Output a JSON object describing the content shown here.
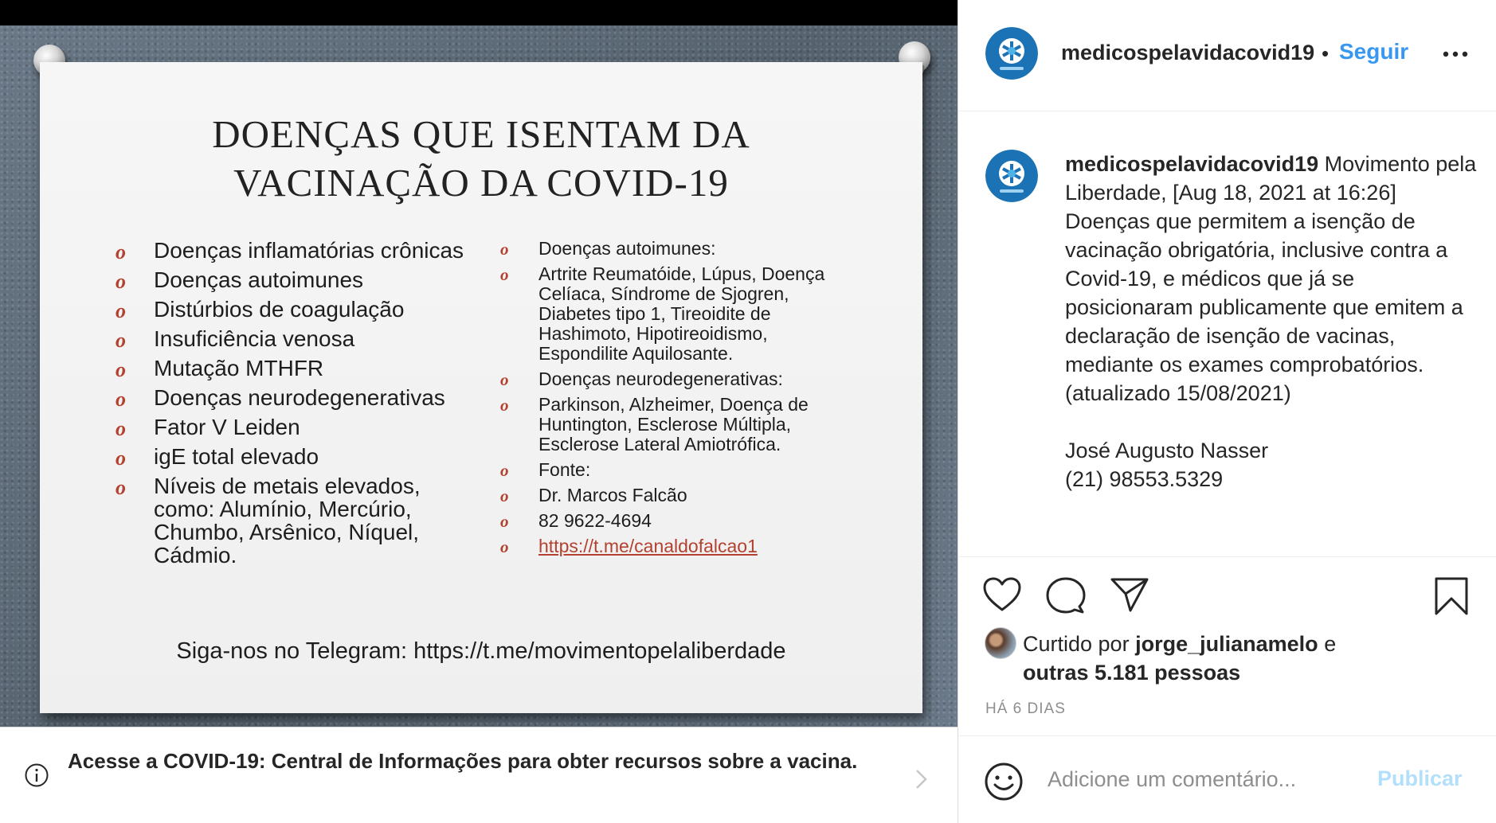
{
  "post_image": {
    "title_line1": "DOENÇAS QUE ISENTAM DA",
    "title_line2": "VACINAÇÃO DA COVID-19",
    "bullet_glyph": "o",
    "left_items": [
      "Doenças inflamatórias crônicas",
      "Doenças autoimunes",
      "Distúrbios de coagulação",
      "Insuficiência venosa",
      "Mutação MTHFR",
      "Doenças neurodegenerativas",
      "Fator V Leiden",
      "igE total elevado",
      "Níveis de metais elevados, como: Alumínio, Mercúrio, Chumbo, Arsênico, Níquel, Cádmio."
    ],
    "right_items": [
      "Doenças autoimunes:",
      "Artrite Reumatóide, Lúpus, Doença Celíaca, Síndrome de Sjogren, Diabetes tipo 1, Tireoidite de Hashimoto, Hipotireoidismo, Espondilite Aquilosante.",
      "Doenças neurodegenerativas:",
      "Parkinson, Alzheimer, Doença de Huntington, Esclerose Múltipla, Esclerose Lateral Amiotrófica.",
      "Fonte:",
      "Dr. Marcos Falcão",
      "82 9622-4694",
      "https://t.me/canaldofalcao1"
    ],
    "telegram_line": "Siga-nos no Telegram: https://t.me/movimentopelaliberdade"
  },
  "notice": {
    "text": "Acesse a COVID-19: Central de Informações para obter recursos sobre a vacina.",
    "icon": "info-icon",
    "chevron_icon": "chevron-right-icon"
  },
  "header": {
    "username": "medicospelavidacovid19",
    "separator": "•",
    "follow_label": "Seguir",
    "more_icon": "more-horizontal-icon"
  },
  "caption": {
    "author": "medicospelavidacovid19",
    "lead": "Movimento pela Liberdade, [Aug 18, 2021 at 16:26]",
    "body": "Doenças que permitem a isenção de vacinação obrigatória, inclusive contra a Covid-19, e médicos que já se posicionaram publicamente que emitem a declaração de isenção de vacinas, mediante os exames comprobatórios.\n(atualizado 15/08/2021)\n\nJosé Augusto Nasser\n(21) 98553.5329"
  },
  "actions": {
    "likes_prefix": "Curtido por",
    "liker": "jorge_julianamelo",
    "likes_joiner": "e",
    "likes_rest": "outras 5.181 pessoas",
    "timestamp": "HÁ 6 DIAS"
  },
  "comment": {
    "placeholder": "Adicione um comentário...",
    "publish_label": "Publicar"
  },
  "colors": {
    "link_blue": "#3897f0",
    "publish_disabled": "#b2dffc",
    "bullet_red": "#b4412f",
    "muted_text": "#8e8e8e"
  }
}
